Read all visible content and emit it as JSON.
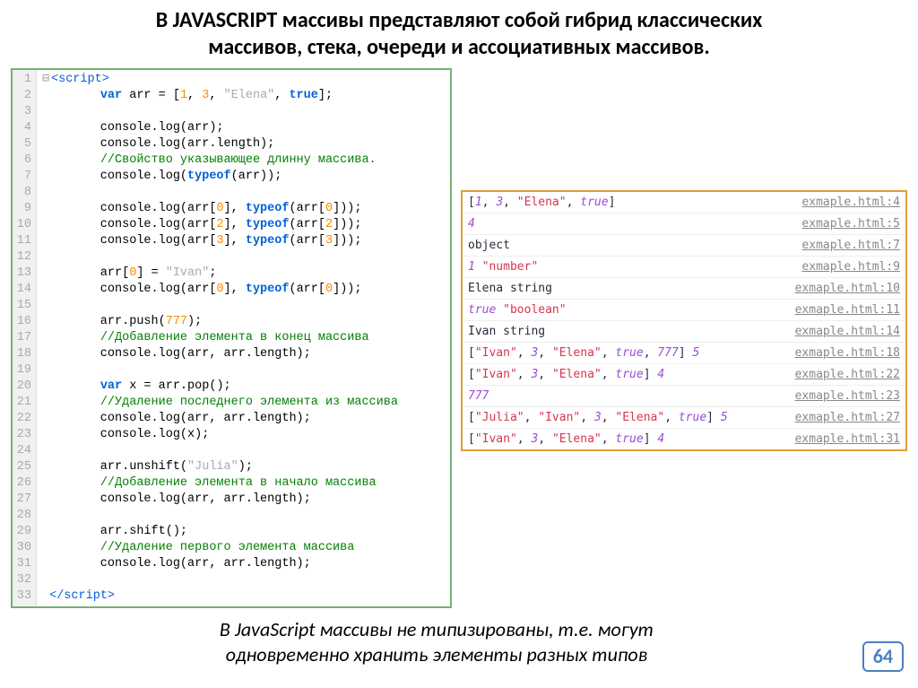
{
  "title_line1": "В JAVASCRIPT массивы представляют собой гибрид классических",
  "title_line2": "массивов, стека, очереди и ассоциативных массивов.",
  "footer_line1": "В JavaScript массивы не типизированы, т.е. могут",
  "footer_line2": "одновременно хранить элементы разных типов",
  "page_number": "64",
  "code_lines": [
    {
      "n": "1",
      "html": "<span class='fold'>⊟</span><span class='tag'>&lt;script&gt;</span>"
    },
    {
      "n": "2",
      "html": "        <span class='k-blue'>var</span> arr = [<span class='num'>1</span>, <span class='num'>3</span>, <span class='str'>\"Elena\"</span>, <span class='bool'>true</span>];"
    },
    {
      "n": "3",
      "html": ""
    },
    {
      "n": "4",
      "html": "        console.log(arr);"
    },
    {
      "n": "5",
      "html": "        console.log(arr.length);"
    },
    {
      "n": "6",
      "html": "        <span class='comment'>//Свойство указывающее длинну массива.</span>"
    },
    {
      "n": "7",
      "html": "        console.log(<span class='k-blue'>typeof</span>(arr));"
    },
    {
      "n": "8",
      "html": ""
    },
    {
      "n": "9",
      "html": "        console.log(arr[<span class='num'>0</span>], <span class='k-blue'>typeof</span>(arr[<span class='num'>0</span>]));"
    },
    {
      "n": "10",
      "html": "        console.log(arr[<span class='num'>2</span>], <span class='k-blue'>typeof</span>(arr[<span class='num'>2</span>]));"
    },
    {
      "n": "11",
      "html": "        console.log(arr[<span class='num'>3</span>], <span class='k-blue'>typeof</span>(arr[<span class='num'>3</span>]));"
    },
    {
      "n": "12",
      "html": ""
    },
    {
      "n": "13",
      "html": "        arr[<span class='num'>0</span>] = <span class='str'>\"Ivan\"</span>;"
    },
    {
      "n": "14",
      "html": "        console.log(arr[<span class='num'>0</span>], <span class='k-blue'>typeof</span>(arr[<span class='num'>0</span>]));"
    },
    {
      "n": "15",
      "html": ""
    },
    {
      "n": "16",
      "html": "        arr.push(<span class='num'>777</span>);"
    },
    {
      "n": "17",
      "html": "        <span class='comment'>//Добавление элемента в конец массива</span>"
    },
    {
      "n": "18",
      "html": "        console.log(arr, arr.length);"
    },
    {
      "n": "19",
      "html": ""
    },
    {
      "n": "20",
      "html": "        <span class='k-blue'>var</span> x = arr.pop();"
    },
    {
      "n": "21",
      "html": "        <span class='comment'>//Удаление последнего элемента из массива</span>"
    },
    {
      "n": "22",
      "html": "        console.log(arr, arr.length);"
    },
    {
      "n": "23",
      "html": "        console.log(x);"
    },
    {
      "n": "24",
      "html": ""
    },
    {
      "n": "25",
      "html": "        arr.unshift(<span class='str'>\"Julia\"</span>);"
    },
    {
      "n": "26",
      "html": "        <span class='comment'>//Добавление элемента в начало массива</span>"
    },
    {
      "n": "27",
      "html": "        console.log(arr, arr.length);"
    },
    {
      "n": "28",
      "html": ""
    },
    {
      "n": "29",
      "html": "        arr.shift();"
    },
    {
      "n": "30",
      "html": "        <span class='comment'>//Удаление первого элемента массива</span>"
    },
    {
      "n": "31",
      "html": "        console.log(arr, arr.length);"
    },
    {
      "n": "32",
      "html": ""
    },
    {
      "n": "33",
      "html": " <span class='tag'>&lt;/script&gt;</span>"
    }
  ],
  "console_rows": [
    {
      "out": "[<span class='c-purple'>1</span>, <span class='c-purple'>3</span>, <span class='c-red'>\"Elena\"</span>, <span class='c-purple'>true</span>]",
      "link": "exmaple.html:4"
    },
    {
      "out": "<span class='c-purple'>4</span>",
      "link": "exmaple.html:5"
    },
    {
      "out": "object",
      "link": "exmaple.html:7"
    },
    {
      "out": "<span class='c-purple'>1</span> <span class='c-red'>\"number\"</span>",
      "link": "exmaple.html:9"
    },
    {
      "out": "Elena string",
      "link": "exmaple.html:10"
    },
    {
      "out": "<span class='c-purple'>true</span> <span class='c-red'>\"boolean\"</span>",
      "link": "exmaple.html:11"
    },
    {
      "out": "Ivan string",
      "link": "exmaple.html:14"
    },
    {
      "out": "[<span class='c-red'>\"Ivan\"</span>, <span class='c-purple'>3</span>, <span class='c-red'>\"Elena\"</span>, <span class='c-purple'>true</span>, <span class='c-purple'>777</span>] <span class='c-purple'>5</span>",
      "link": "exmaple.html:18"
    },
    {
      "out": "[<span class='c-red'>\"Ivan\"</span>, <span class='c-purple'>3</span>, <span class='c-red'>\"Elena\"</span>, <span class='c-purple'>true</span>] <span class='c-purple'>4</span>",
      "link": "exmaple.html:22"
    },
    {
      "out": "<span class='c-purple'>777</span>",
      "link": "exmaple.html:23"
    },
    {
      "out": "[<span class='c-red'>\"Julia\"</span>, <span class='c-red'>\"Ivan\"</span>, <span class='c-purple'>3</span>, <span class='c-red'>\"Elena\"</span>, <span class='c-purple'>true</span>] <span class='c-purple'>5</span>",
      "link": "exmaple.html:27"
    },
    {
      "out": "[<span class='c-red'>\"Ivan\"</span>, <span class='c-purple'>3</span>, <span class='c-red'>\"Elena\"</span>, <span class='c-purple'>true</span>] <span class='c-purple'>4</span>",
      "link": "exmaple.html:31"
    }
  ]
}
